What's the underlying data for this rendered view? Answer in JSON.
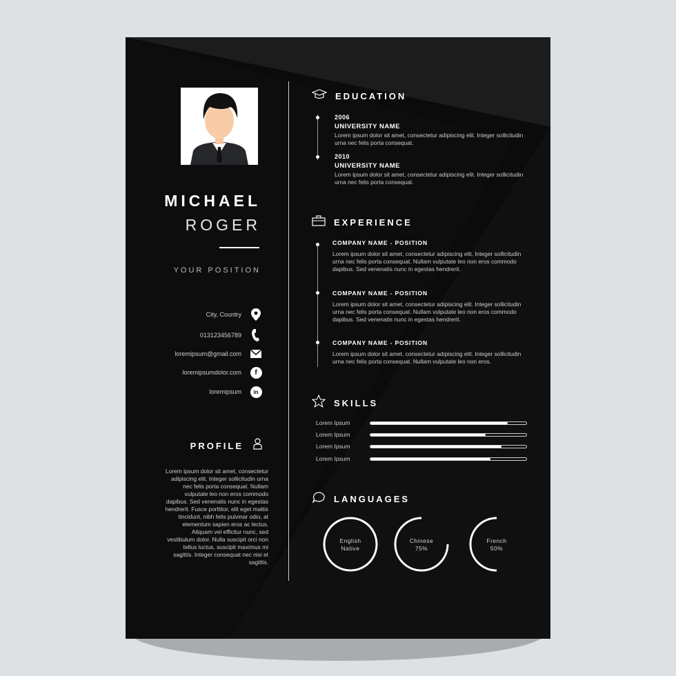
{
  "name": {
    "first": "MICHAEL",
    "last": "ROGER",
    "position": "YOUR POSITION"
  },
  "contacts": [
    {
      "text": "City, Country",
      "icon": "location-pin-icon"
    },
    {
      "text": "013123456789",
      "icon": "phone-icon"
    },
    {
      "text": "loremipsum@gmail.com",
      "icon": "mail-icon"
    },
    {
      "text": "loremipsumdolor.com",
      "icon": "facebook-icon",
      "glyph": "f"
    },
    {
      "text": "loremipsum",
      "icon": "linkedin-icon",
      "glyph": "in"
    }
  ],
  "profile": {
    "title": "PROFILE",
    "icon": "person-icon",
    "text": "Lorem ipsum dolor sit amet, consectetur adipiscing elit. Integer sollicitudin urna nec felis porta consequat. Nullam vulputate leo non eros commodo dapibus. Sed venenatis nunc in egestas hendrerit. Fusce porttitor, elit eget mattis tincidunt, nibh felis pulvinar odio, at elementum sapien eros ac lectus. Aliquam vel efficitur nunc, sed vestibulum dolor. Nulla suscipit orci non tellus luctus, suscipit maximus mi sagittis. Integer consequat nec nisi et sagittis."
  },
  "education": {
    "title": "EDUCATION",
    "icon": "graduation-cap-icon",
    "entries": [
      {
        "year": "2006",
        "school": "UNIVERSITY NAME",
        "desc": "Lorem ipsum dolor sit amet, consectetur adipiscing elit. Integer sollicitudin urna nec felis porta consequat."
      },
      {
        "year": "2010",
        "school": "UNIVERSITY NAME",
        "desc": "Lorem ipsum dolor sit amet, consectetur adipiscing elit. Integer sollicitudin urna nec felis porta consequat."
      }
    ]
  },
  "experience": {
    "title": "EXPERIENCE",
    "icon": "briefcase-icon",
    "entries": [
      {
        "company": "COMPANY NAME - POSITION",
        "desc": "Lorem ipsum dolor sit amet, consectetur adipiscing elit. Integer sollicitudin urna nec felis porta consequat. Nullam vulputate leo non eros commodo dapibus. Sed venenatis nunc in egestas hendrerit."
      },
      {
        "company": "COMPANY NAME - POSITION",
        "desc": "Lorem ipsum dolor sit amet, consectetur adipiscing elit. Integer sollicitudin urna nec felis porta consequat. Nullam vulputate leo non eros commodo dapibus. Sed venenatis nunc in egestas hendrerit."
      },
      {
        "company": "COMPANY NAME - POSITION",
        "desc": "Lorem ipsum dolor sit amet, consectetur adipiscing elit. Integer sollicitudin urna nec felis porta consequat. Nullam vulputate leo non eros."
      }
    ]
  },
  "skills": {
    "title": "SKILLS",
    "icon": "star-icon",
    "items": [
      {
        "label": "Lorem Ipsum",
        "level": 0.88
      },
      {
        "label": "Lorem Ipsum",
        "level": 0.74
      },
      {
        "label": "Lorem Ipsum",
        "level": 0.84
      },
      {
        "label": "Lorem Ipsum",
        "level": 0.77
      }
    ]
  },
  "languages": {
    "title": "LANGUAGES",
    "icon": "speech-bubble-icon",
    "items": [
      {
        "name": "English",
        "level_text": "Native",
        "level": 1.0
      },
      {
        "name": "Chinese",
        "level_text": "75%",
        "level": 0.75
      },
      {
        "name": "French",
        "level_text": "50%",
        "level": 0.5
      }
    ]
  },
  "colors": {
    "background": "#0b0b0b",
    "page": "#dde1e4",
    "text": "#ffffff",
    "muted": "#cfcfcf"
  }
}
